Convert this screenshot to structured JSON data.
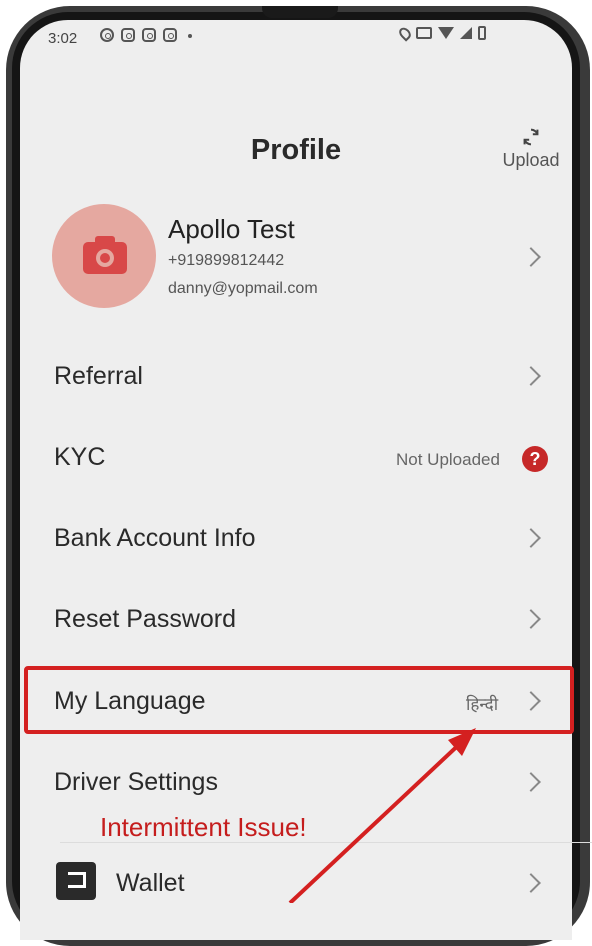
{
  "status_bar": {
    "time": "3:02"
  },
  "header": {
    "title": "Profile",
    "upload_label": "Upload"
  },
  "profile": {
    "name": "Apollo Test",
    "phone": "+919899812442",
    "email": "danny@yopmail.com"
  },
  "menu": {
    "referral": "Referral",
    "kyc": "KYC",
    "kyc_status": "Not Uploaded",
    "bank": "Bank Account Info",
    "reset_password": "Reset Password",
    "my_language": "My Language",
    "language_value": "हिन्दी",
    "driver_settings": "Driver Settings",
    "wallet": "Wallet"
  },
  "annotation": {
    "text": "Intermittent Issue!"
  },
  "colors": {
    "accent": "#c62828",
    "annotation": "#d42020",
    "avatar_bg": "#e5a8a0"
  }
}
